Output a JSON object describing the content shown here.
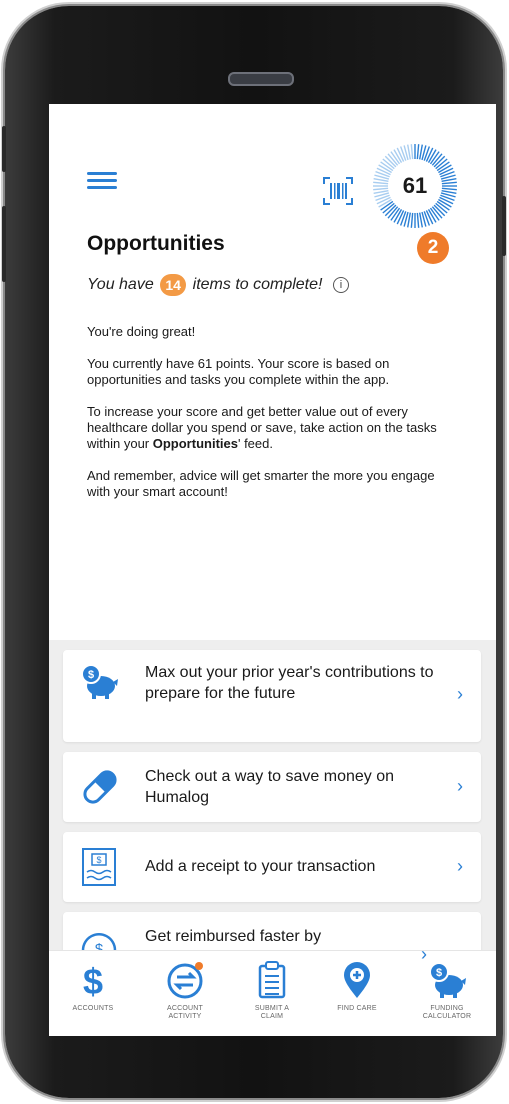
{
  "header": {
    "menu_icon": "hamburger-menu-icon",
    "scan_icon": "barcode-scan-icon",
    "score_value": "61",
    "score_badge": "2"
  },
  "opportunities": {
    "title": "Opportunities",
    "subtitle_prefix": "You have",
    "item_count": "14",
    "subtitle_suffix": "items to complete!",
    "info_glyph": "i"
  },
  "body": {
    "p1": "You're doing great!",
    "p2": "You currently have 61 points. Your score is based on opportunities and tasks you complete within the app.",
    "p3_before": "To increase your score and get better value out of every healthcare dollar you spend or save, take action on the tasks within your ",
    "p3_bold": "Opportunities",
    "p3_after": "' feed.",
    "p4": "And remember, advice will get smarter the more you engage with your smart account!"
  },
  "feed": {
    "cards": [
      {
        "icon": "piggy-bank-icon",
        "text": "Max out your prior year's contributions to prepare for the future"
      },
      {
        "icon": "pill-icon",
        "text": "Check out a way to save money on Humalog"
      },
      {
        "icon": "receipt-icon",
        "text": "Add a receipt to your transaction"
      },
      {
        "icon": "reimburse-icon",
        "text": "Get reimbursed faster by"
      }
    ],
    "chevron": "›"
  },
  "tabs": [
    {
      "icon": "dollar-icon",
      "label": "ACCOUNTS"
    },
    {
      "icon": "account-activity-icon",
      "label": "ACCOUNT ACTIVITY"
    },
    {
      "icon": "clipboard-icon",
      "label": "SUBMIT A CLAIM"
    },
    {
      "icon": "location-pin-icon",
      "label": "FIND CARE"
    },
    {
      "icon": "piggy-bank-icon",
      "label": "FUNDING CALCULATOR"
    }
  ],
  "colors": {
    "accent": "#2a7fd4",
    "badge_orange": "#ef7b2a",
    "feed_background": "#eeeeee"
  }
}
